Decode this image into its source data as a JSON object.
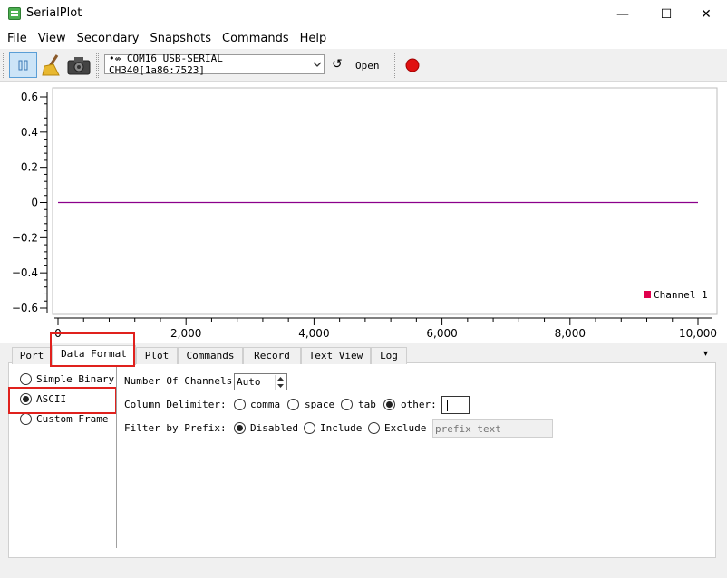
{
  "window": {
    "title": "SerialPlot",
    "minimize_glyph": "—",
    "maximize_glyph": "☐",
    "close_glyph": "✕"
  },
  "menu": [
    "File",
    "View",
    "Secondary",
    "Snapshots",
    "Commands",
    "Help"
  ],
  "toolbar": {
    "port_value": "•⇎ COM16 USB-SERIAL CH340[1a86:7523]",
    "refresh_glyph": "↺",
    "open_label": "Open",
    "icons": [
      "pause-icon",
      "clear-icon",
      "snapshot-camera-icon",
      "record-icon"
    ],
    "record_color": "#e01010"
  },
  "chart_data": {
    "type": "line",
    "xlim": [
      0,
      10000
    ],
    "ylim": [
      -0.6,
      0.6
    ],
    "x_ticks": [
      "0",
      "2,000",
      "4,000",
      "6,000",
      "8,000",
      "10,000"
    ],
    "y_ticks": [
      "0.6",
      "0.4",
      "0.2",
      "0",
      "−0.2",
      "−0.4",
      "−0.6"
    ],
    "series": [
      {
        "name": "Channel 1",
        "color": "#8b008b",
        "x": [
          0,
          10000
        ],
        "y": [
          0,
          0
        ]
      }
    ],
    "legend_position": "bottom-right",
    "legend_color": "#e0004c",
    "grid": false
  },
  "tabs": [
    "Port",
    "Data Format",
    "Plot",
    "Commands",
    "Record",
    "Text View",
    "Log"
  ],
  "tabs_active": "Data Format",
  "tab_overflow_glyph": "▾",
  "format": {
    "options": [
      "Simple Binary",
      "ASCII",
      "Custom Frame"
    ],
    "selected": "ASCII",
    "channels_label": "Number Of Channels:",
    "channels_value": "Auto",
    "delimiter_label": "Column Delimiter:",
    "delimiters": [
      "comma",
      "space",
      "tab",
      "other:"
    ],
    "delimiter_selected": "other:",
    "filter_label": "Filter by Prefix:",
    "filters": [
      "Disabled",
      "Include",
      "Exclude"
    ],
    "filter_selected": "Disabled",
    "prefix_placeholder": "prefix text"
  }
}
